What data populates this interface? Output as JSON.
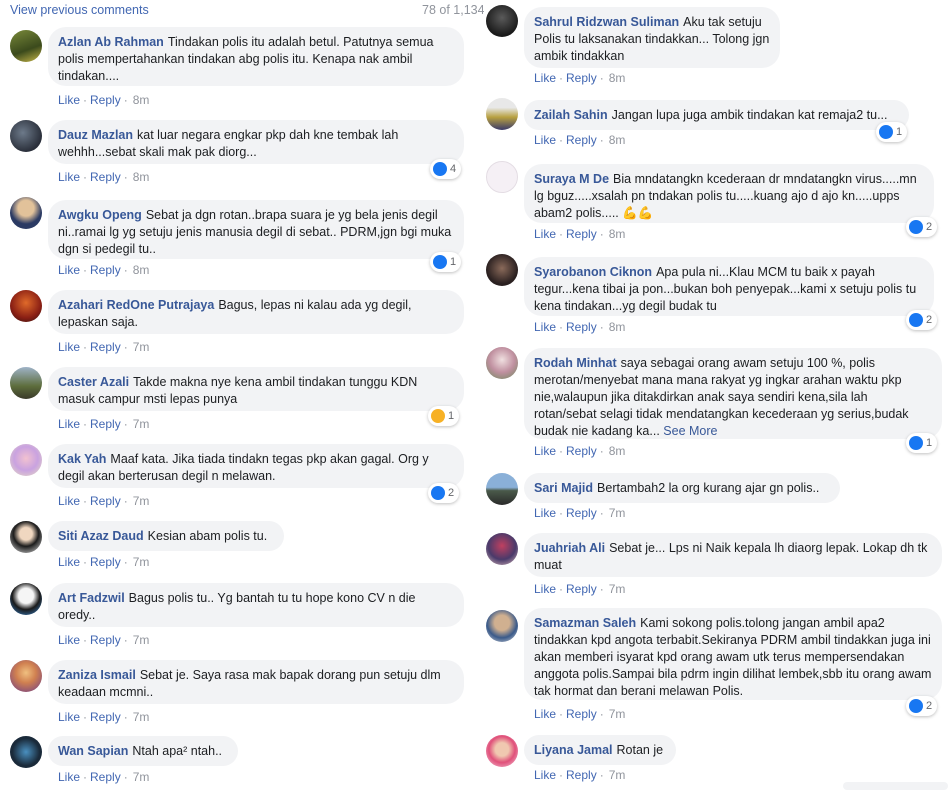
{
  "header": {
    "view_previous": "View previous comments",
    "count": "78 of 1,134"
  },
  "comment_meta": {
    "like_label": "Like",
    "reply_label": "Reply",
    "separator": "·",
    "see_more_label": "See More",
    "muscle_emoji": "💪💪"
  },
  "colors": {
    "link": "#4267b2",
    "author": "#385898",
    "bubble": "#f2f3f5",
    "like_blue": "#1877f2",
    "haha_yellow": "#f7b125"
  },
  "left": [
    {
      "author": "Azlan Ab Rahman",
      "text": "Tindakan polis itu adalah betul. Patutnya semua polis mempertahankan tindakan abg polis itu. Kenapa nak ambil tindakan....",
      "time": "8m",
      "reaction": null
    },
    {
      "author": "Dauz Mazlan",
      "text": "kat luar negara engkar pkp dah kne tembak lah wehhh...sebat skali mak pak diorg...",
      "time": "8m",
      "reaction": {
        "type": "like-icon",
        "count": "4"
      }
    },
    {
      "author": "Awgku Openg",
      "text": "Sebat ja dgn rotan..brapa suara je yg bela jenis degil ni..ramai lg yg setuju jenis manusia degil di sebat.. PDRM,jgn bgi muka dgn si pedegil tu..",
      "time": "8m",
      "reaction": {
        "type": "like-icon",
        "count": "1"
      }
    },
    {
      "author": "Azahari RedOne Putrajaya",
      "text": "Bagus, lepas ni kalau ada yg degil, lepaskan saja.",
      "time": "7m",
      "reaction": null
    },
    {
      "author": "Caster Azali",
      "text": "Takde makna nye kena ambil tindakan tunggu KDN masuk campur msti lepas punya",
      "time": "7m",
      "reaction": {
        "type": "haha-icon",
        "count": "1"
      }
    },
    {
      "author": "Kak Yah",
      "text": "Maaf kata. Jika tiada tindakn tegas pkp akan gagal. Org y degil akan berterusan degil n melawan.",
      "time": "7m",
      "reaction": {
        "type": "like-icon",
        "count": "2"
      }
    },
    {
      "author": "Siti Azaz Daud",
      "text": "Kesian abam polis tu.",
      "time": "7m",
      "reaction": null
    },
    {
      "author": "Art Fadzwil",
      "text": "Bagus polis tu.. Yg bantah tu tu hope kono CV n die oredy..",
      "time": "7m",
      "reaction": null
    },
    {
      "author": "Zaniza Ismail",
      "text": "Sebat je. Saya rasa mak bapak dorang pun setuju dlm keadaan mcmni..",
      "time": "7m",
      "reaction": null
    },
    {
      "author": "Wan Sapian",
      "text": "Ntah apa² ntah..",
      "time": "7m",
      "reaction": null
    }
  ],
  "right": [
    {
      "author": "Sahrul Ridzwan Suliman",
      "text": "Aku tak setuju Polis tu laksanakan tindakkan... Tolong jgn ambik tindakkan",
      "time": "8m",
      "reaction": null
    },
    {
      "author": "Zailah Sahin",
      "text": "Jangan lupa juga ambik tindakan kat remaja2 tu...",
      "time": "8m",
      "reaction": {
        "type": "like-icon",
        "count": "1"
      }
    },
    {
      "author": "Suraya M De",
      "text": "Bia mndatangkn kcederaan dr mndatangkn virus.....mn lg bguz.....xsalah pn tndakan polis tu.....kuang ajo d ajo kn.....upps abam2 polis.....",
      "time": "8m",
      "reaction": {
        "type": "like-icon",
        "count": "2"
      }
    },
    {
      "author": "Syarobanon Ciknon",
      "text": "Apa pula ni...Klau MCM tu baik x payah tegur...kena tibai ja pon...bukan boh penyepak...kami x setuju polis tu kena tindakan...yg degil budak tu",
      "time": "8m",
      "reaction": {
        "type": "like-icon",
        "count": "2"
      }
    },
    {
      "author": "Rodah Minhat",
      "text": "saya sebagai orang awam setuju 100 %, polis merotan/menyebat mana mana rakyat yg ingkar arahan waktu pkp nie,walaupun jika ditakdirkan anak saya sendiri kena,sila lah rotan/sebat selagi tidak mendatangkan kecederaan yg serius,budak budak nie kadang ka...",
      "time": "8m",
      "reaction": {
        "type": "like-icon",
        "count": "1"
      }
    },
    {
      "author": "Sari Majid",
      "text": "Bertambah2 la org kurang ajar gn polis..",
      "time": "7m",
      "reaction": null
    },
    {
      "author": "Juahriah Ali",
      "text": "Sebat je... Lps ni Naik kepala lh diaorg lepak. Lokap dh tk muat",
      "time": "7m",
      "reaction": null
    },
    {
      "author": "Samazman Saleh",
      "text": "Kami sokong polis.tolong jangan ambil apa2 tindakkan kpd angota terbabit.Sekiranya PDRM ambil tindakkan juga ini akan memberi isyarat kpd orang awam utk terus mempersendakan anggota polis.Sampai bila pdrm ingin dilihat lembek,sbb itu orang awam tak hormat dan berani melawan Polis.",
      "time": "7m",
      "reaction": {
        "type": "like-icon",
        "count": "2"
      }
    },
    {
      "author": "Liyana Jamal",
      "text": "Rotan je",
      "time": "7m",
      "reaction": null
    }
  ]
}
